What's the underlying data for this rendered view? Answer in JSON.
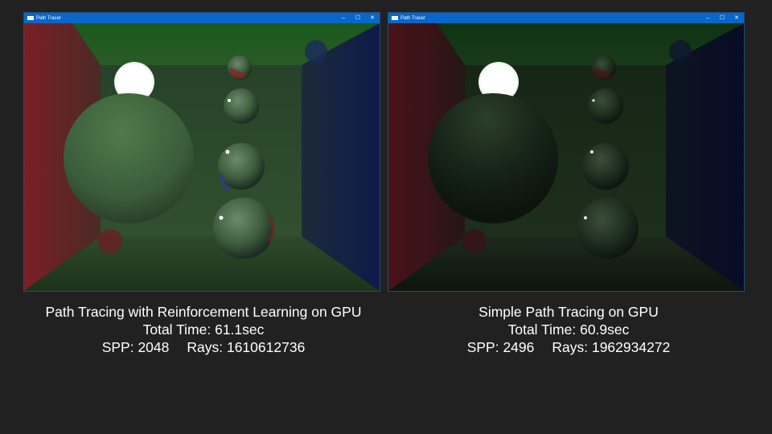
{
  "windows": [
    {
      "title": "Path Tracer",
      "controls": {
        "minimize": "–",
        "maximize": "☐",
        "close": "✕"
      }
    },
    {
      "title": "Path Tracer",
      "controls": {
        "minimize": "–",
        "maximize": "☐",
        "close": "✕"
      }
    }
  ],
  "captions": {
    "left": {
      "method": "Path Tracing with Reinforcement Learning on GPU",
      "total_time": "Total Time: 61.1sec",
      "spp": "SPP: 2048",
      "rays": "Rays: 1610612736"
    },
    "right": {
      "method": "Simple Path Tracing on GPU",
      "total_time": "Total Time: 60.9sec",
      "spp": "SPP: 2496",
      "rays": "Rays: 1962934272"
    }
  },
  "colors": {
    "background": "#212121",
    "titlebar": "#0a66c8",
    "caption_text": "#ffffff"
  }
}
